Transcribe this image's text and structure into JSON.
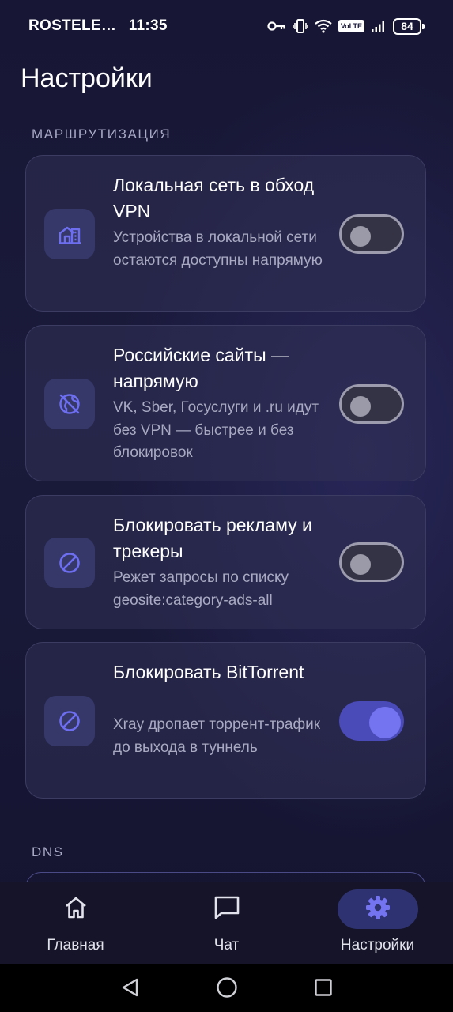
{
  "status_bar": {
    "carrier": "ROSTELE…",
    "time": "11:35",
    "volte": "VoLTE",
    "battery": "84"
  },
  "page": {
    "title": "Настройки"
  },
  "sections": {
    "routing": "МАРШРУТИЗАЦИЯ",
    "dns": "DNS"
  },
  "cards": [
    {
      "title": "Локальная сеть в обход VPN",
      "desc": "Устройства в локальной сети остаются доступны напрямую",
      "icon": "local-network-icon",
      "enabled": false
    },
    {
      "title": "Российские сайты — напрямую",
      "desc": "VK, Sber, Госуслуги и .ru идут без VPN — быстрее и без блокировок",
      "icon": "globe-off-icon",
      "enabled": false
    },
    {
      "title": "Блокировать рекламу и трекеры",
      "desc": "Режет запросы по списку geosite:category-ads-all",
      "icon": "block-icon",
      "enabled": false
    },
    {
      "title": "Блокировать BitTorrent",
      "desc": "Xray дропает торрент-трафик до выхода в туннель",
      "icon": "block-icon",
      "enabled": true
    }
  ],
  "bottom_nav": [
    {
      "label": "Главная",
      "icon": "home-icon",
      "active": false
    },
    {
      "label": "Чат",
      "icon": "chat-icon",
      "active": false
    },
    {
      "label": "Настройки",
      "icon": "gear-icon",
      "active": true
    }
  ],
  "colors": {
    "accent": "#7474f0",
    "icon_accent": "#6d6ff0",
    "card_icon_bg": "#36386a",
    "active_nav_bg": "#2f3270"
  }
}
